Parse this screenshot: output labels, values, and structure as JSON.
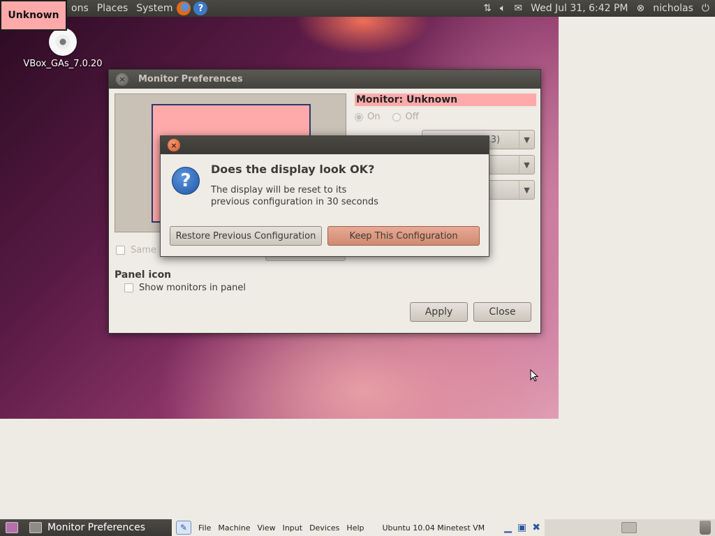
{
  "top_panel": {
    "menus": [
      "ons",
      "Places",
      "System"
    ],
    "network_icon": "network-arrows-icon",
    "volume_icon": "volume-icon",
    "mail_icon": "mail-icon",
    "datetime": "Wed Jul 31,  6:42 PM",
    "user": "nicholas"
  },
  "unknown_overlay": {
    "label": "Unknown"
  },
  "desktop_icon": {
    "label": "VBox_GAs_7.0.20"
  },
  "monitor_window": {
    "title": "Monitor Preferences",
    "monitor_label": "Monitor: Unknown",
    "on_label": "On",
    "off_label": "Off",
    "resolution_value": "(4:3)",
    "same_image_label": "Same",
    "panel_icon_heading": "Panel icon",
    "show_monitors_label": "Show monitors in panel",
    "apply_label": "Apply",
    "close_label": "Close"
  },
  "confirm_dialog": {
    "heading": "Does the display look OK?",
    "body_line1": "The display will be reset to its",
    "body_line2": "previous configuration in 30 seconds",
    "restore_label": "Restore Previous Configuration",
    "keep_label": "Keep This Configuration"
  },
  "vbox_bar": {
    "task_label": "Monitor Preferences",
    "menus": [
      "File",
      "Machine",
      "View",
      "Input",
      "Devices",
      "Help"
    ],
    "vm_title": "Ubuntu 10.04 Minetest VM"
  },
  "colors": {
    "highlight": "#ffaaaa",
    "panel": "#3a3935",
    "window_bg": "#efebe5"
  }
}
